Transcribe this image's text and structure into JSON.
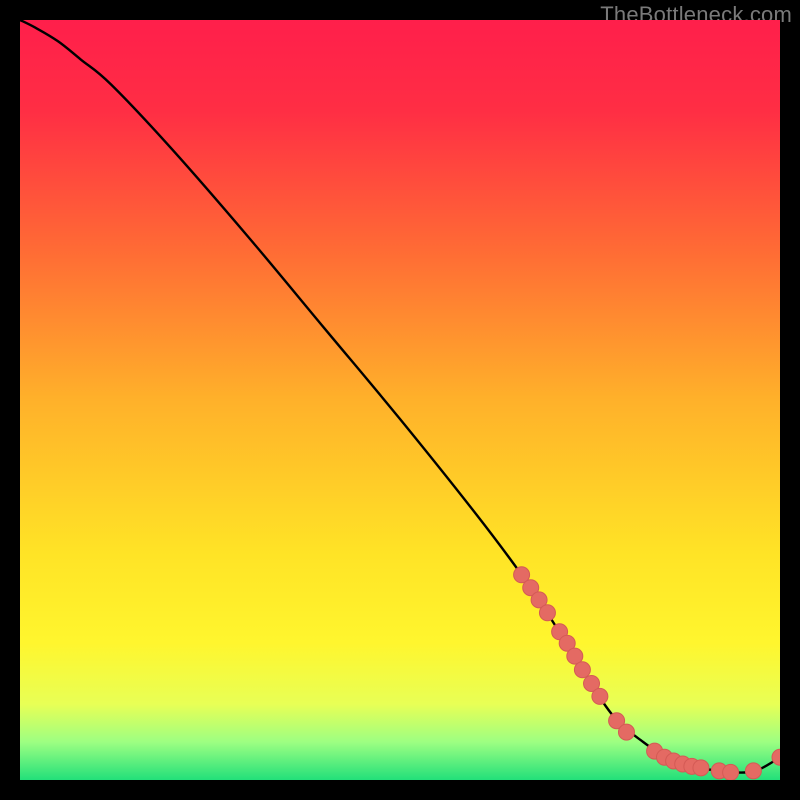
{
  "watermark": "TheBottleneck.com",
  "colors": {
    "gradient_stops": [
      {
        "offset": 0.0,
        "color": "#ff1f4b"
      },
      {
        "offset": 0.12,
        "color": "#ff2e44"
      },
      {
        "offset": 0.3,
        "color": "#ff6a35"
      },
      {
        "offset": 0.5,
        "color": "#ffb12a"
      },
      {
        "offset": 0.7,
        "color": "#ffe326"
      },
      {
        "offset": 0.82,
        "color": "#fff62e"
      },
      {
        "offset": 0.9,
        "color": "#e8ff55"
      },
      {
        "offset": 0.95,
        "color": "#9dff82"
      },
      {
        "offset": 1.0,
        "color": "#22e07a"
      }
    ],
    "curve": "#000000",
    "marker_fill": "#e46a63",
    "marker_stroke": "#d45a55"
  },
  "chart_data": {
    "type": "line",
    "title": "",
    "xlabel": "",
    "ylabel": "",
    "xlim": [
      0,
      100
    ],
    "ylim": [
      0,
      100
    ],
    "series": [
      {
        "name": "curve",
        "x": [
          0,
          2,
          5,
          8,
          12,
          20,
          30,
          40,
          50,
          60,
          66,
          70,
          74,
          78,
          82,
          86,
          90,
          94,
          97,
          100
        ],
        "y": [
          100,
          99.0,
          97.2,
          94.8,
          91.5,
          83.0,
          71.5,
          59.5,
          47.5,
          35.0,
          27.0,
          21.0,
          14.5,
          8.5,
          5.0,
          2.5,
          1.5,
          1.0,
          1.3,
          3.0
        ]
      }
    ],
    "markers": [
      {
        "x": 66.0,
        "y": 27.0
      },
      {
        "x": 67.2,
        "y": 25.3
      },
      {
        "x": 68.3,
        "y": 23.7
      },
      {
        "x": 69.4,
        "y": 22.0
      },
      {
        "x": 71.0,
        "y": 19.5
      },
      {
        "x": 72.0,
        "y": 18.0
      },
      {
        "x": 73.0,
        "y": 16.3
      },
      {
        "x": 74.0,
        "y": 14.5
      },
      {
        "x": 75.2,
        "y": 12.7
      },
      {
        "x": 76.3,
        "y": 11.0
      },
      {
        "x": 78.5,
        "y": 7.8
      },
      {
        "x": 79.8,
        "y": 6.3
      },
      {
        "x": 83.5,
        "y": 3.8
      },
      {
        "x": 84.8,
        "y": 3.0
      },
      {
        "x": 86.0,
        "y": 2.5
      },
      {
        "x": 87.2,
        "y": 2.1
      },
      {
        "x": 88.4,
        "y": 1.8
      },
      {
        "x": 89.6,
        "y": 1.6
      },
      {
        "x": 92.0,
        "y": 1.2
      },
      {
        "x": 93.5,
        "y": 1.0
      },
      {
        "x": 96.5,
        "y": 1.2
      },
      {
        "x": 100.0,
        "y": 3.0
      }
    ]
  }
}
